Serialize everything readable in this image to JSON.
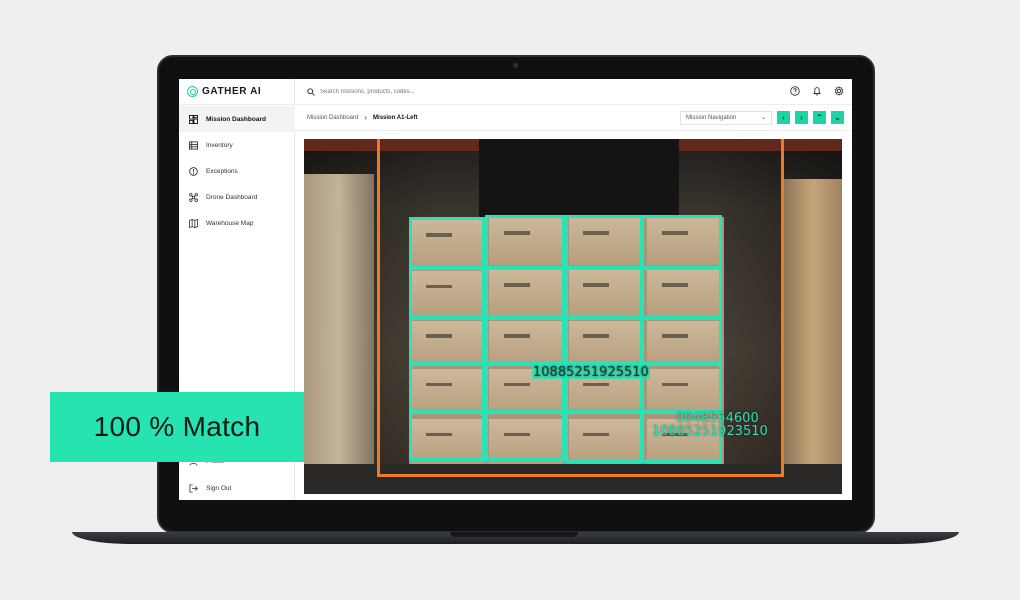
{
  "brand": {
    "name": "GATHER AI"
  },
  "sidebar": {
    "items": [
      {
        "label": "Mission Dashboard",
        "icon": "dashboard-icon"
      },
      {
        "label": "Inventory",
        "icon": "inventory-icon"
      },
      {
        "label": "Exceptions",
        "icon": "exceptions-icon"
      },
      {
        "label": "Drone Dashboard",
        "icon": "drone-icon"
      },
      {
        "label": "Warehouse Map",
        "icon": "map-icon"
      }
    ],
    "bottom": [
      {
        "label": "Profile",
        "icon": "profile-icon"
      },
      {
        "label": "Sign Out",
        "icon": "sign-out-icon"
      }
    ]
  },
  "search": {
    "placeholder": "Search missions, products, codes..."
  },
  "breadcrumb": {
    "parent": "Mission Dashboard",
    "current": "Mission A1-Left"
  },
  "mission_nav": {
    "label": "Mission Navigation"
  },
  "nav_buttons": {
    "prev": "‹",
    "next": "›",
    "up": "⌃",
    "down": "⌄"
  },
  "detections": {
    "label_1": "10885251925510",
    "label_2": "0048554600",
    "label_3": "10885251923510"
  },
  "badge": {
    "text": "100 % Match"
  },
  "colors": {
    "accent": "#27e3b0",
    "frame": "#f07a23"
  }
}
